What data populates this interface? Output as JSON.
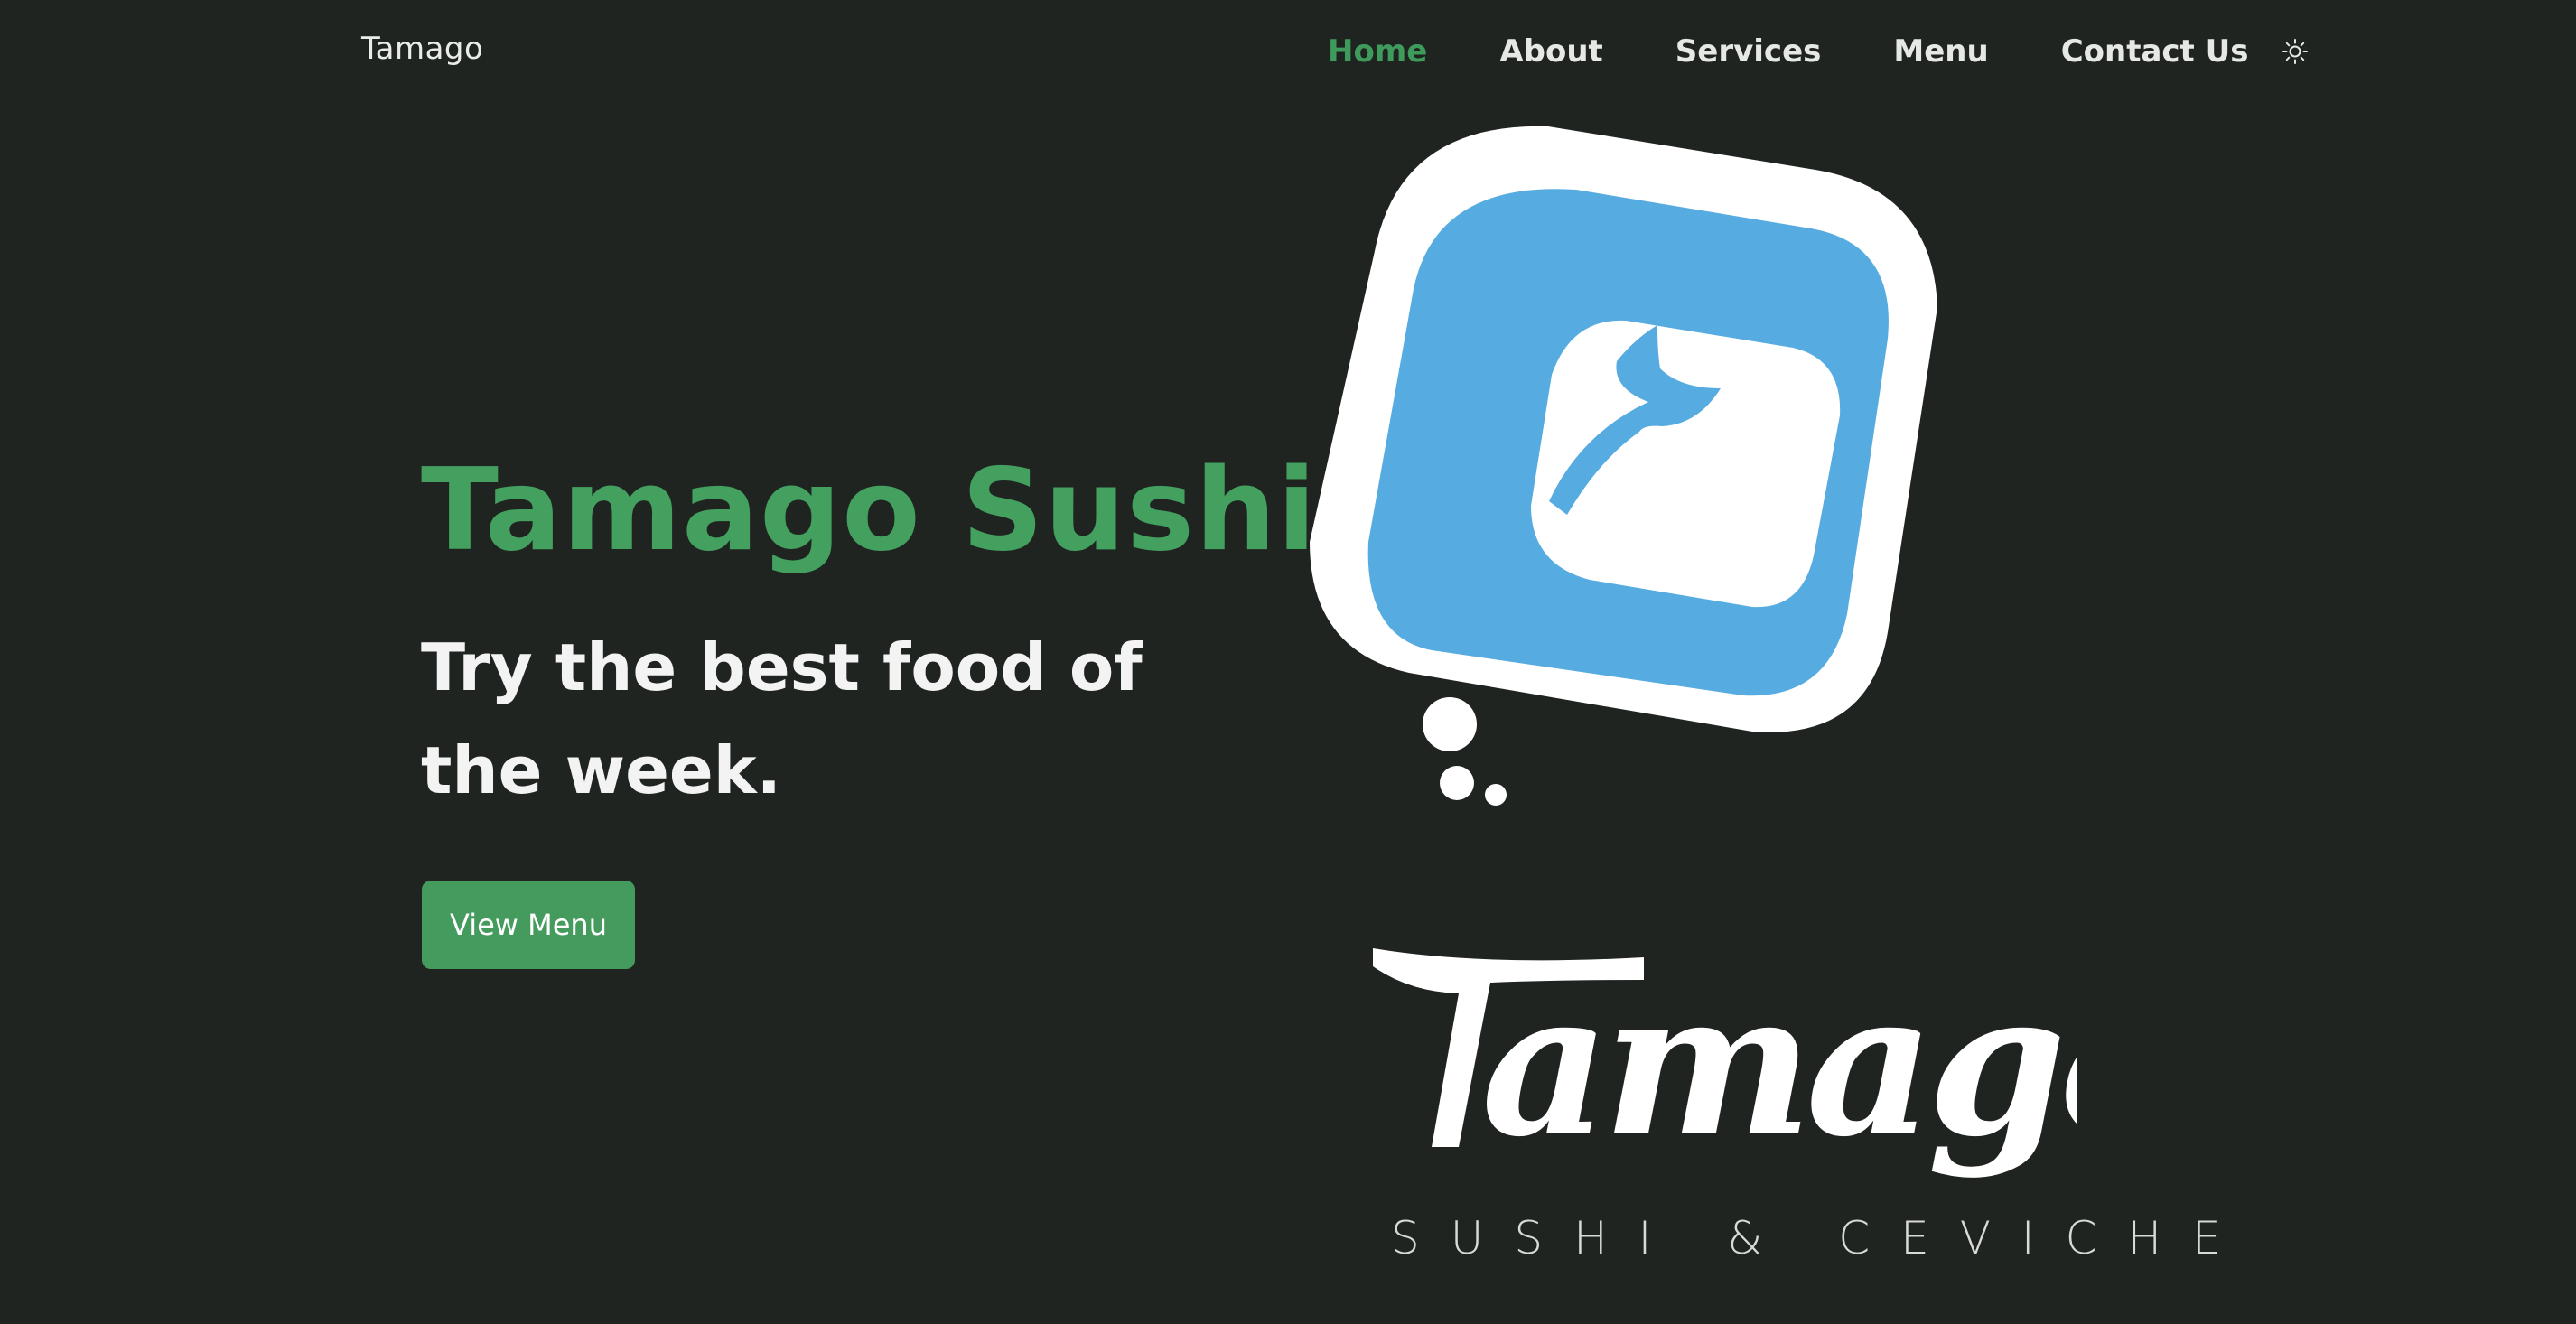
{
  "header": {
    "brand": "Tamago",
    "nav": [
      {
        "label": "Home",
        "active": true
      },
      {
        "label": "About",
        "active": false
      },
      {
        "label": "Services",
        "active": false
      },
      {
        "label": "Menu",
        "active": false
      },
      {
        "label": "Contact Us",
        "active": false
      }
    ],
    "theme_icon": "sun-icon"
  },
  "hero": {
    "title": "Tamago Sushi",
    "subtitle": "Try the best food of the week.",
    "cta_label": "View Menu"
  },
  "logo": {
    "wordmark": "Tamago",
    "tagline": "SUSHI & CEVICHE",
    "icon": "fish-tail-icon"
  },
  "colors": {
    "background": "#1f2421",
    "accent_green": "#43a05f",
    "button_green": "#449b5d",
    "logo_blue": "#56abe0",
    "text_light": "#f2f3f2"
  }
}
